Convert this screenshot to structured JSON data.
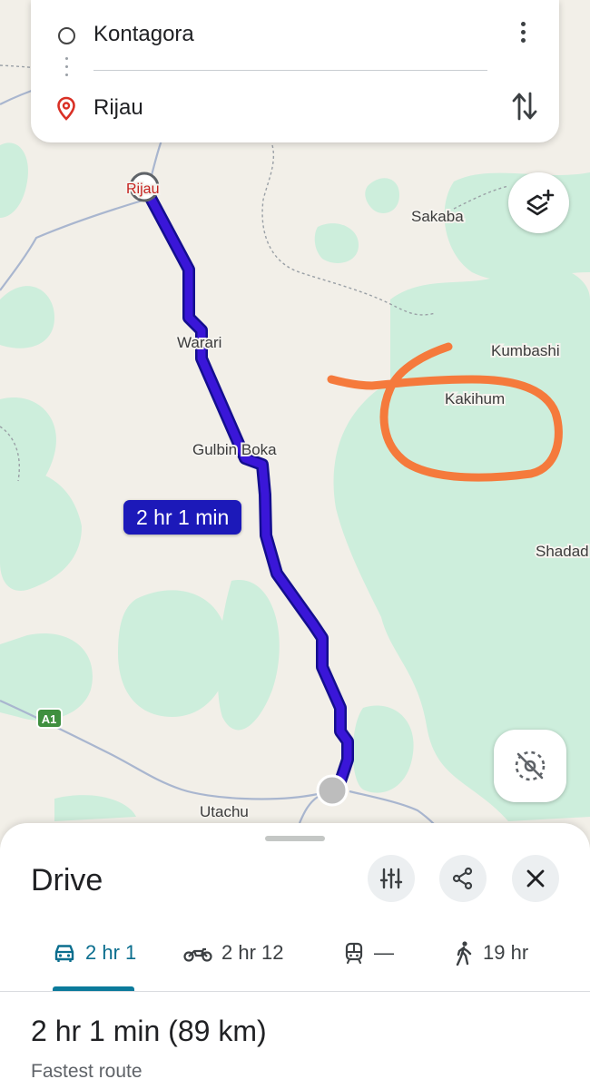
{
  "search": {
    "origin": "Kontagora",
    "destination": "Rijau"
  },
  "map": {
    "places": {
      "rijau": "Rijau",
      "sakaba": "Sakaba",
      "kumbashi": "Kumbashi",
      "kakihum": "Kakihum",
      "warari": "Warari",
      "gulbin_boka": "Gulbin Boka",
      "shadadi_partial": "Shadad",
      "utachu": "Utachu"
    },
    "highway_shield": "A1",
    "route_duration": "2 hr 1 min",
    "colors": {
      "route": "#2b14c9",
      "land": "#f2efe8",
      "forest": "#cdf0dc",
      "annotation": "#f57a3c",
      "road": "#a9b6cf"
    }
  },
  "sheet": {
    "title": "Drive",
    "modes": [
      {
        "icon": "car-icon",
        "label": "2 hr 1",
        "selected": true
      },
      {
        "icon": "motorcycle-icon",
        "label": "2 hr 12"
      },
      {
        "icon": "train-icon",
        "label": "—"
      },
      {
        "icon": "walking-icon",
        "label": "19 hr"
      }
    ],
    "summary": "2 hr 1 min (89 km)",
    "note": "Fastest route"
  }
}
